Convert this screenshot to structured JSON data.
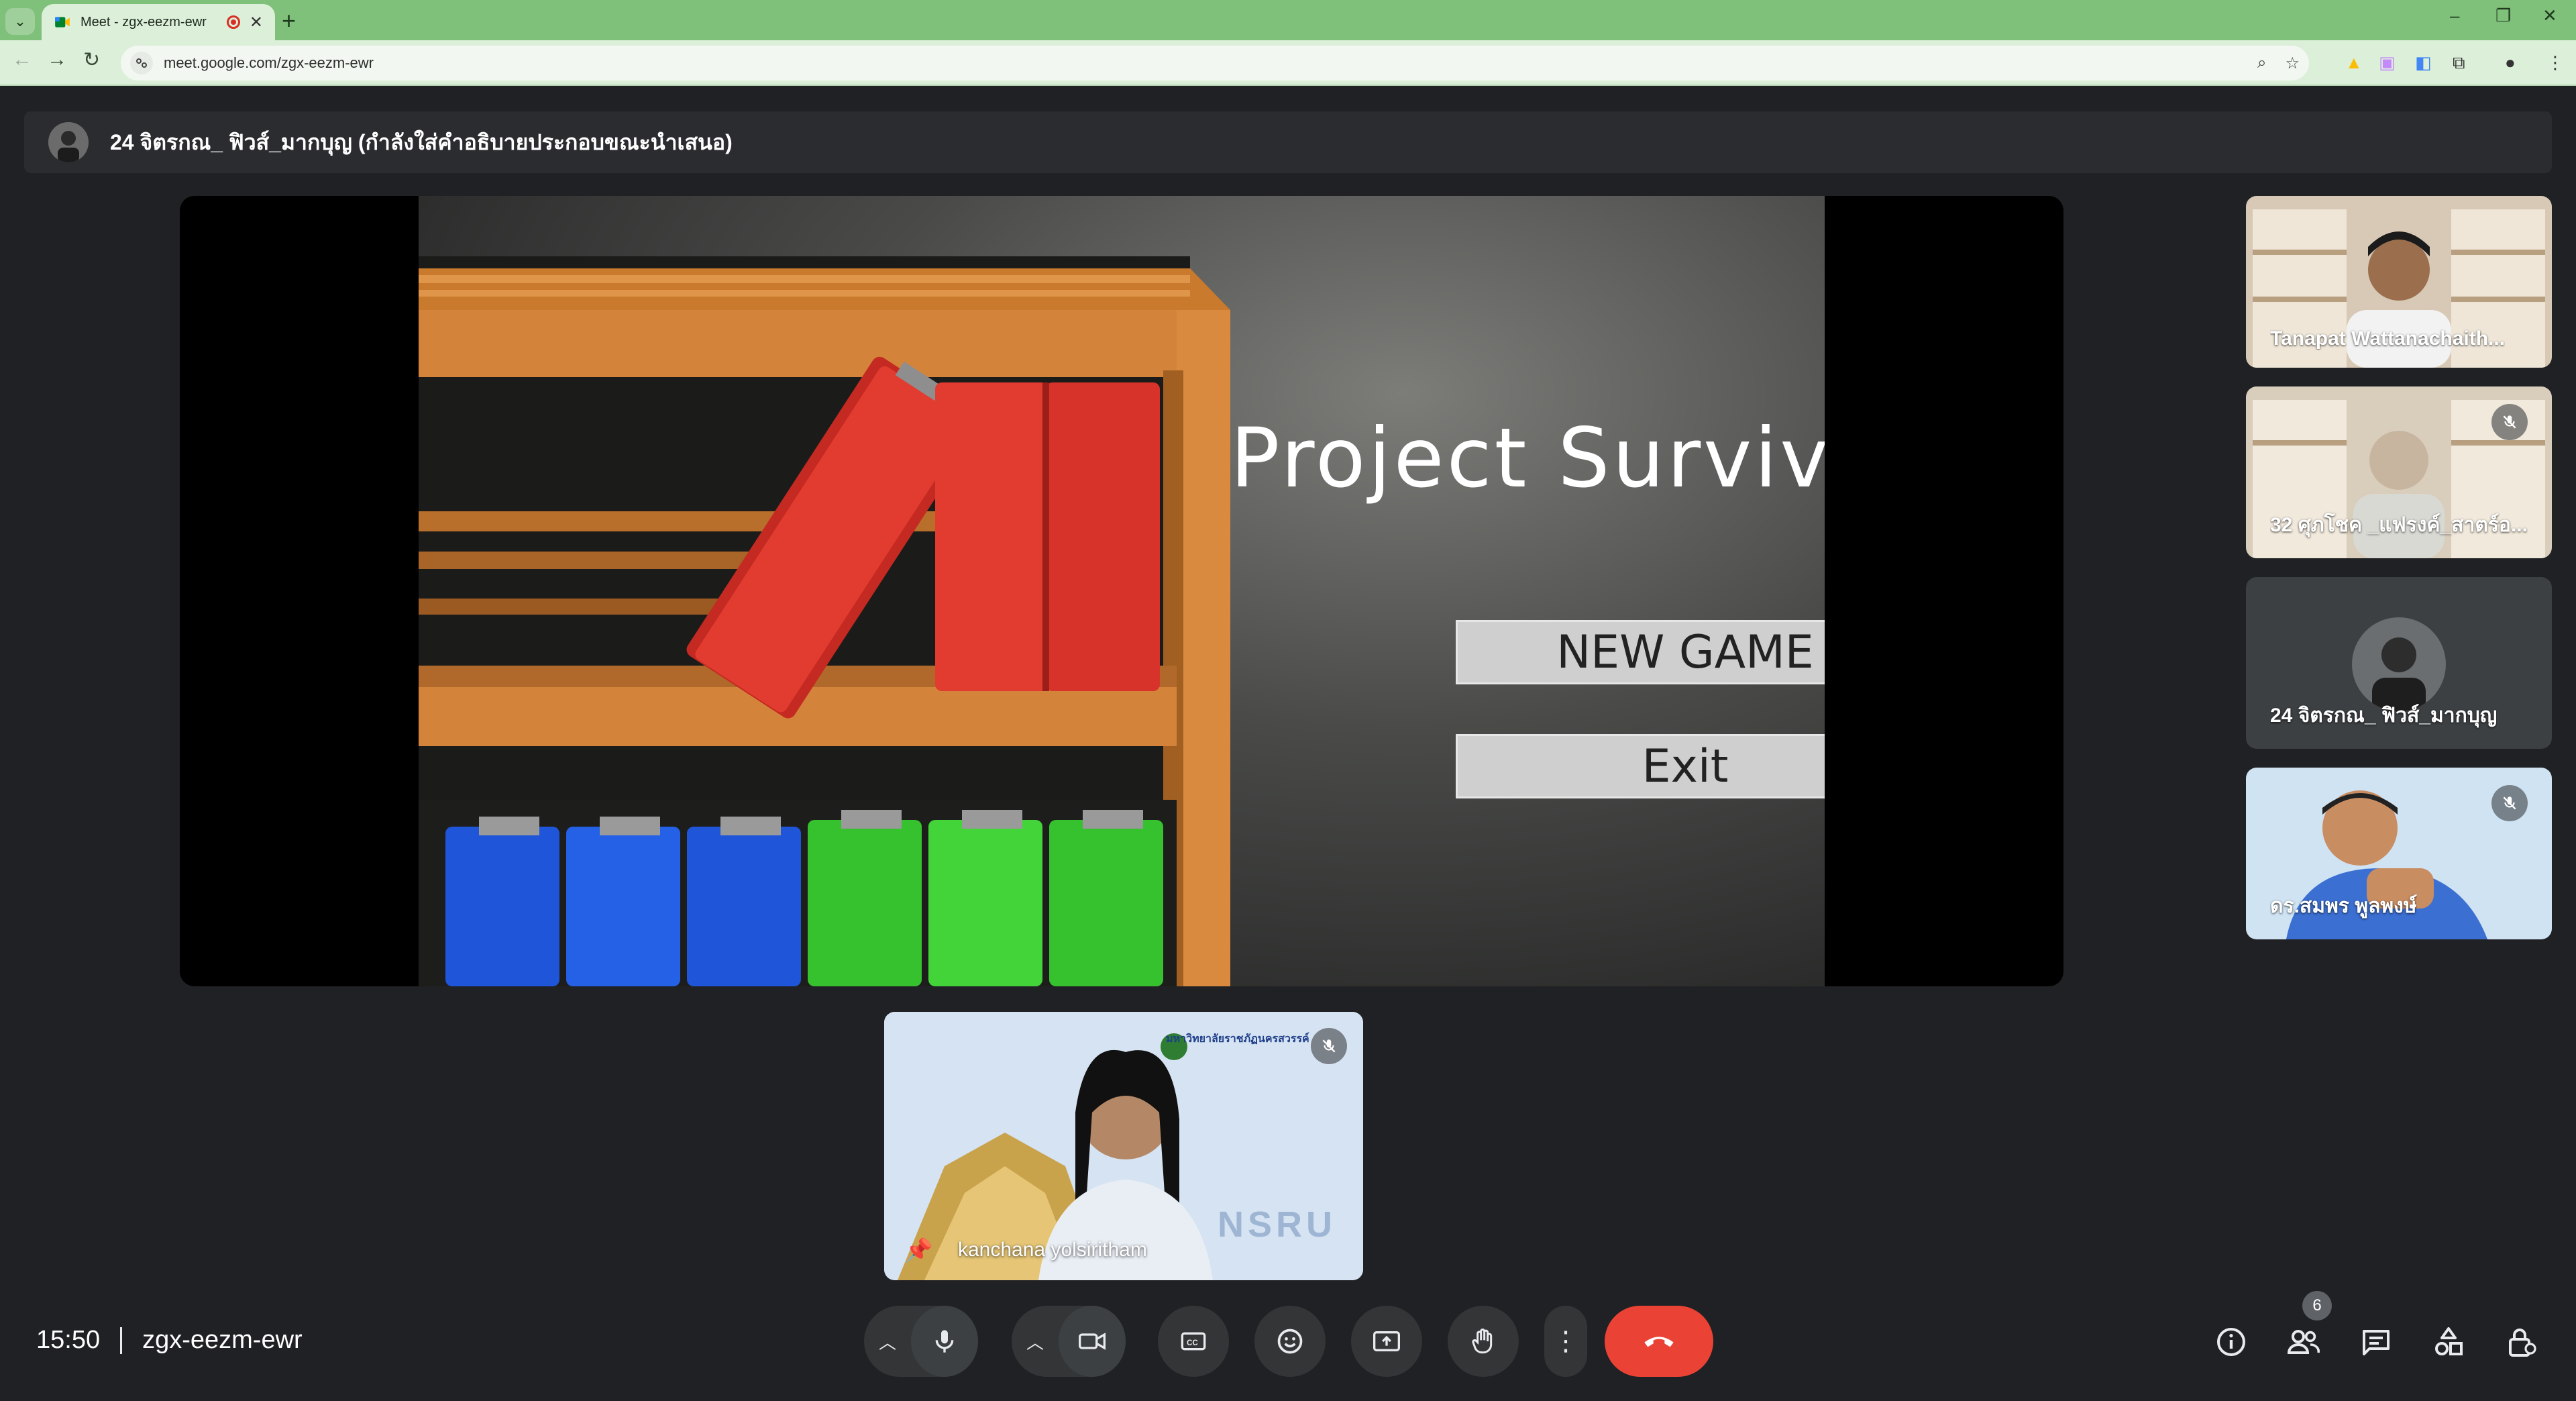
{
  "browser": {
    "tab_title": "Meet - zgx-eezm-ewr",
    "new_tab_symbol": "+",
    "url": "meet.google.com/zgx-eezm-ewr",
    "window_controls": [
      "–",
      "❐",
      "✕"
    ]
  },
  "presenter": {
    "text": "24 จิตรกณ_ ฟิวส์_มากบุญ (กำลังใส่คำอธิบายประกอบขณะนำเสนอ)"
  },
  "game": {
    "title": "Project Survival",
    "new_game_label": "NEW GAME",
    "exit_label": "Exit"
  },
  "participants": [
    {
      "name": "Tanapat Wattanachaith...",
      "muted": false
    },
    {
      "name": "32 ศุภโชค _แฟรงค์_สาตร์อ...",
      "muted": true
    },
    {
      "name": "24 จิตรกณ_ ฟิวส์_มากบุญ",
      "muted": false
    },
    {
      "name": "ดร.สมพร พูลพงษ์",
      "muted": true
    }
  ],
  "pinned": {
    "name": "kanchana yolsiritham",
    "watermark": "NSRU",
    "university": "มหาวิทยาลัยราชภัฏนครสวรรค์"
  },
  "meeting": {
    "time": "15:50",
    "code": "zgx-eezm-ewr",
    "participant_count": "6"
  },
  "colors": {
    "accent_green": "#7fc07a",
    "end_call": "#ea4335",
    "background": "#202124"
  }
}
